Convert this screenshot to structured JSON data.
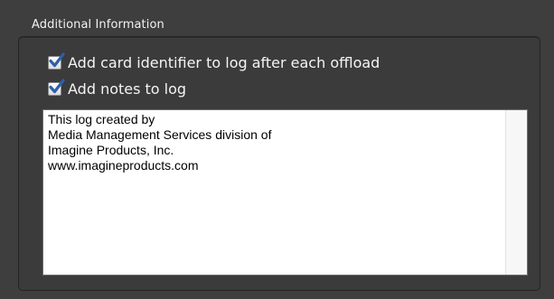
{
  "section": {
    "title": "Additional Information"
  },
  "options": {
    "card_identifier": {
      "label": "Add card identifier to log after each offload",
      "checked": true
    },
    "add_notes": {
      "label": "Add notes to log",
      "checked": true
    }
  },
  "notes": {
    "text": "This log created by\nMedia Management Services division of\nImagine Products, Inc.\nwww.imagineproducts.com"
  },
  "icons": {
    "checkbox_mark": "checkmark-icon"
  },
  "colors": {
    "background": "#3e3e3e",
    "checkmark": "#2f5fa8",
    "text_light": "#f4f4f4"
  }
}
